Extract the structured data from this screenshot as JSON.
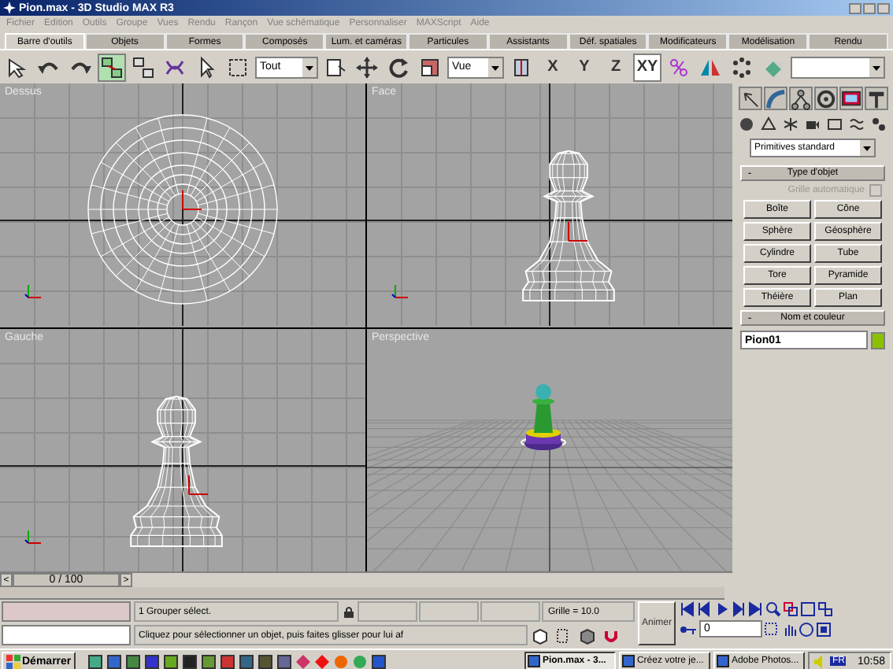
{
  "window": {
    "title": "Pion.max - 3D Studio MAX R3"
  },
  "menu": [
    "Fichier",
    "Edition",
    "Outils",
    "Groupe",
    "Vues",
    "Rendu",
    "Rançon",
    "Vue schématique",
    "Personnaliser",
    "MAXScript",
    "Aide"
  ],
  "tabs": [
    {
      "label": "Barre d'outils",
      "selected": true
    },
    {
      "label": "Objets",
      "selected": false
    },
    {
      "label": "Formes",
      "selected": false
    },
    {
      "label": "Composés",
      "selected": false
    },
    {
      "label": "Lum. et caméras",
      "selected": false
    },
    {
      "label": "Particules",
      "selected": false
    },
    {
      "label": "Assistants",
      "selected": false
    },
    {
      "label": "Déf. spatiales",
      "selected": false
    },
    {
      "label": "Modificateurs",
      "selected": false
    },
    {
      "label": "Modélisation",
      "selected": false
    },
    {
      "label": "Rendu",
      "selected": false
    }
  ],
  "toolbar": {
    "selection_filter": "Tout",
    "reference_system": "Vue",
    "axes": [
      {
        "label": "X",
        "selected": false
      },
      {
        "label": "Y",
        "selected": false
      },
      {
        "label": "Z",
        "selected": false
      },
      {
        "label": "XY",
        "selected": true
      }
    ]
  },
  "viewports": [
    {
      "label": "Dessus",
      "kind": "top"
    },
    {
      "label": "Face",
      "kind": "front"
    },
    {
      "label": "Gauche",
      "kind": "left"
    },
    {
      "label": "Perspective",
      "kind": "perspective"
    }
  ],
  "command_panel": {
    "category": "Primitives standard",
    "object_type": {
      "title": "Type d'objet",
      "toggle": "-",
      "auto_grid": {
        "label": "Grille automatique",
        "checked": false,
        "disabled": true
      },
      "buttons": [
        "Boîte",
        "Cône",
        "Sphère",
        "Géosphère",
        "Cylindre",
        "Tube",
        "Tore",
        "Pyramide",
        "Théière",
        "Plan"
      ]
    },
    "name_color": {
      "title": "Nom et couleur",
      "toggle": "-",
      "name": "Pion01",
      "color": "#8cc000"
    }
  },
  "time_slider": {
    "reading": "0 / 100",
    "prev": "<",
    "next": ">"
  },
  "status": {
    "selection": "1 Grouper sélect.",
    "grid": "Grille = 10.0",
    "prompt": "Cliquez pour sélectionner un objet, puis faites glisser pour lui af",
    "animate": "Animer",
    "frame": "0"
  },
  "taskbar": {
    "start": "Démarrer",
    "tasks": [
      {
        "label": "Pion.max - 3...",
        "selected": true
      },
      {
        "label": "Créez votre je...",
        "selected": false
      },
      {
        "label": "Adobe Photos...",
        "selected": false
      }
    ],
    "language": "FR",
    "clock": "10:58"
  }
}
